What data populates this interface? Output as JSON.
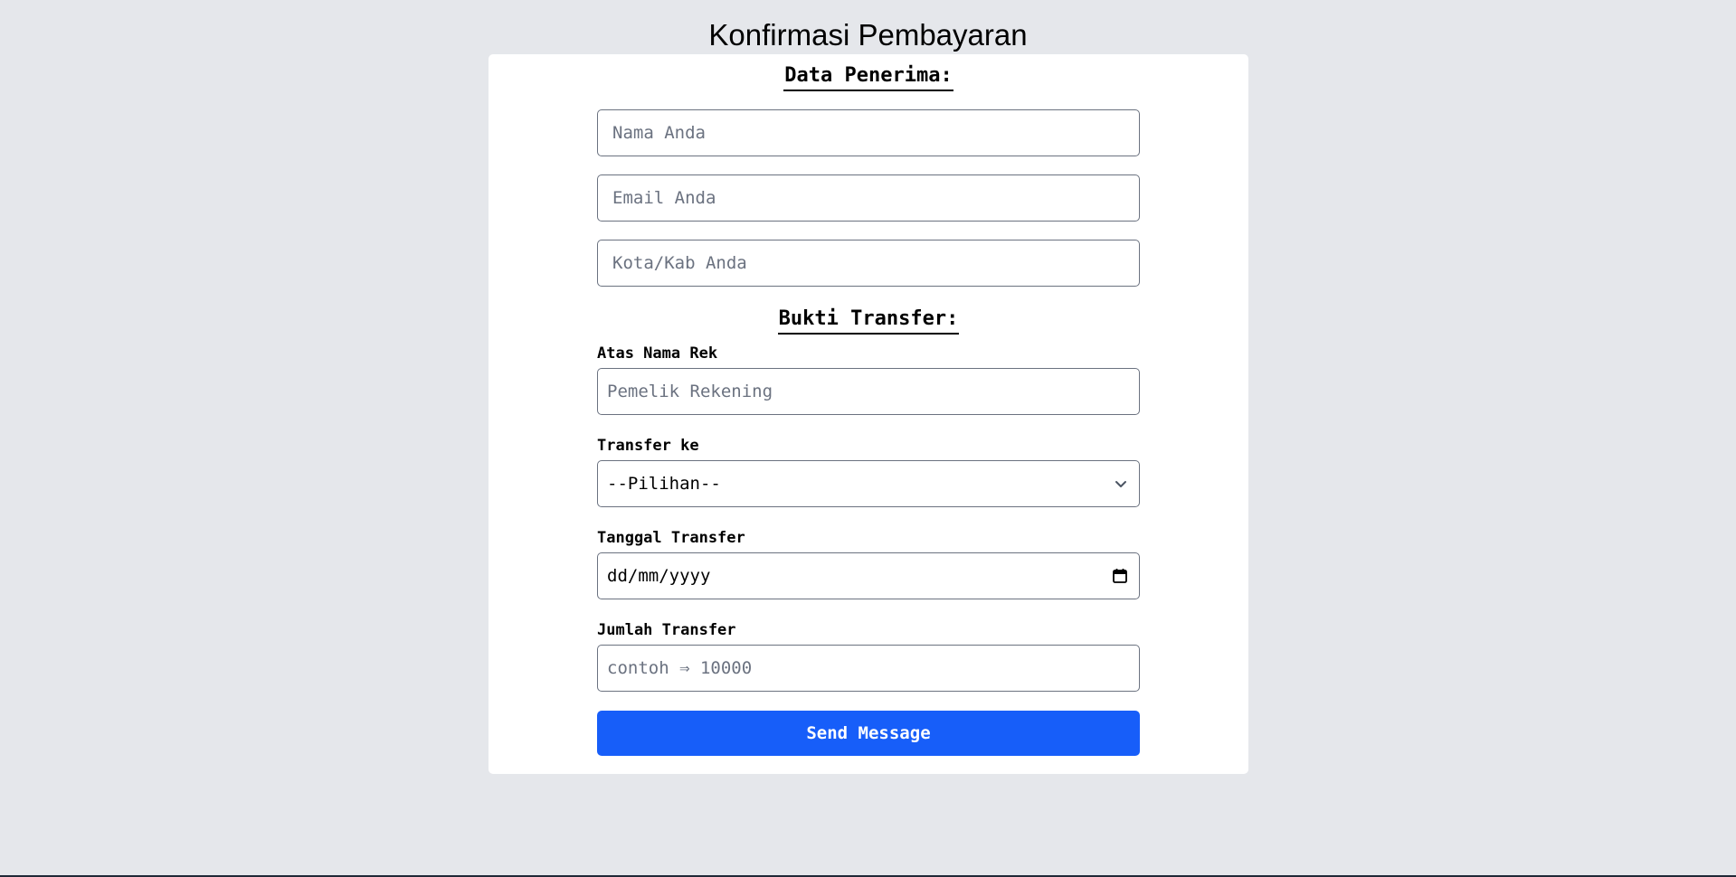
{
  "page": {
    "title": "Konfirmasi Pembayaran"
  },
  "recipient": {
    "heading": "Data Penerima:",
    "name_placeholder": "Nama Anda",
    "email_placeholder": "Email Anda",
    "city_placeholder": "Kota/Kab Anda"
  },
  "transfer": {
    "heading": "Bukti Transfer:",
    "account_name_label": "Atas Nama Rek",
    "account_name_placeholder": "Pemelik Rekening",
    "destination_label": "Transfer ke",
    "destination_selected": "--Pilihan--",
    "date_label": "Tanggal Transfer",
    "date_format": "dd/mm/yyyy",
    "amount_label": "Jumlah Transfer",
    "amount_placeholder": "contoh ⇒ 10000"
  },
  "actions": {
    "submit_label": "Send Message"
  },
  "icons": {
    "select": "chevron-down-icon",
    "date": "calendar-icon"
  },
  "colors": {
    "page_background": "#e5e7eb",
    "card_background": "#ffffff",
    "button_background": "#175ef9",
    "field_border": "#6b7280",
    "placeholder": "#6b7280"
  }
}
